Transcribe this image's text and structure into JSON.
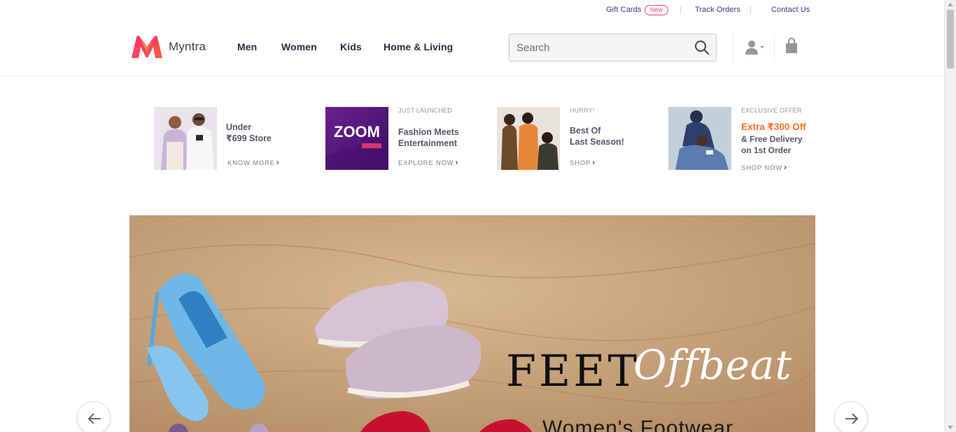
{
  "utility": {
    "gift_cards": "Gift Cards",
    "new_badge": "New",
    "track_orders": "Track Orders",
    "contact_us": "Contact Us"
  },
  "header": {
    "brand": "Myntra",
    "nav": [
      "Men",
      "Women",
      "Kids",
      "Home & Living"
    ],
    "search_placeholder": "Search"
  },
  "promos": [
    {
      "small": "",
      "title_line1": "Under",
      "title_line2": "₹699 Store",
      "cta": "KNOW MORE"
    },
    {
      "small": "JUST LAUNCHED",
      "title_line1": "Fashion Meets",
      "title_line2": "Entertainment",
      "cta": "EXPLORE NOW",
      "image_text": "ZOOM"
    },
    {
      "small": "HURRY!",
      "title_line1": "Best Of",
      "title_line2": "Last Season!",
      "cta": "SHOP"
    },
    {
      "small": "EXCLUSIVE OFFER",
      "highlight": "Extra ₹300 Off",
      "title_line1": "& Free Delivery",
      "title_line2": "on 1st Order",
      "cta": "SHOP NOW"
    }
  ],
  "banner": {
    "heading": "FEET",
    "script": "Offbeat",
    "subheading": "Women's Footwear"
  },
  "colors": {
    "brand_pink": "#ff3f6c",
    "link_blue": "#2b3a8c",
    "offer_orange": "#ff6f1f"
  }
}
